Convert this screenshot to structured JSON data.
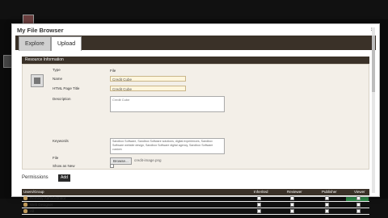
{
  "dialog": {
    "title": "My File Browser",
    "close_label": "×",
    "tabs": [
      {
        "label": "Explore"
      },
      {
        "label": "Upload"
      }
    ]
  },
  "resource_info": {
    "header": "Resource Information",
    "fields": {
      "type_label": "Type",
      "type_value": "File",
      "name_label": "Name",
      "name_value": "Credit Cube",
      "html_title_label": "HTML Page Title",
      "html_title_value": "Credit Cube",
      "description_label": "Description",
      "description_value": "Credit Cube",
      "keywords_label": "Keywords",
      "keywords_value": "Sandbox Software, Sandbox Software solutions, digital experiences, Sandbox Software website design, Sandbox Software digital agency, Sandbox Software custom",
      "file_label": "File",
      "browse_label": "Browse...",
      "file_name": "credit-image.png",
      "show_as_new_label": "Show as New"
    }
  },
  "permissions": {
    "title": "Permissions",
    "add_label": "Add",
    "columns": [
      "Users/Group",
      "Inherited",
      "Reviewer",
      "Publisher",
      "Viewer"
    ],
    "rows": [
      {
        "name": "Remedy Administrator"
      },
      {
        "name": "Web Designer"
      },
      {
        "name": "All"
      }
    ]
  }
}
